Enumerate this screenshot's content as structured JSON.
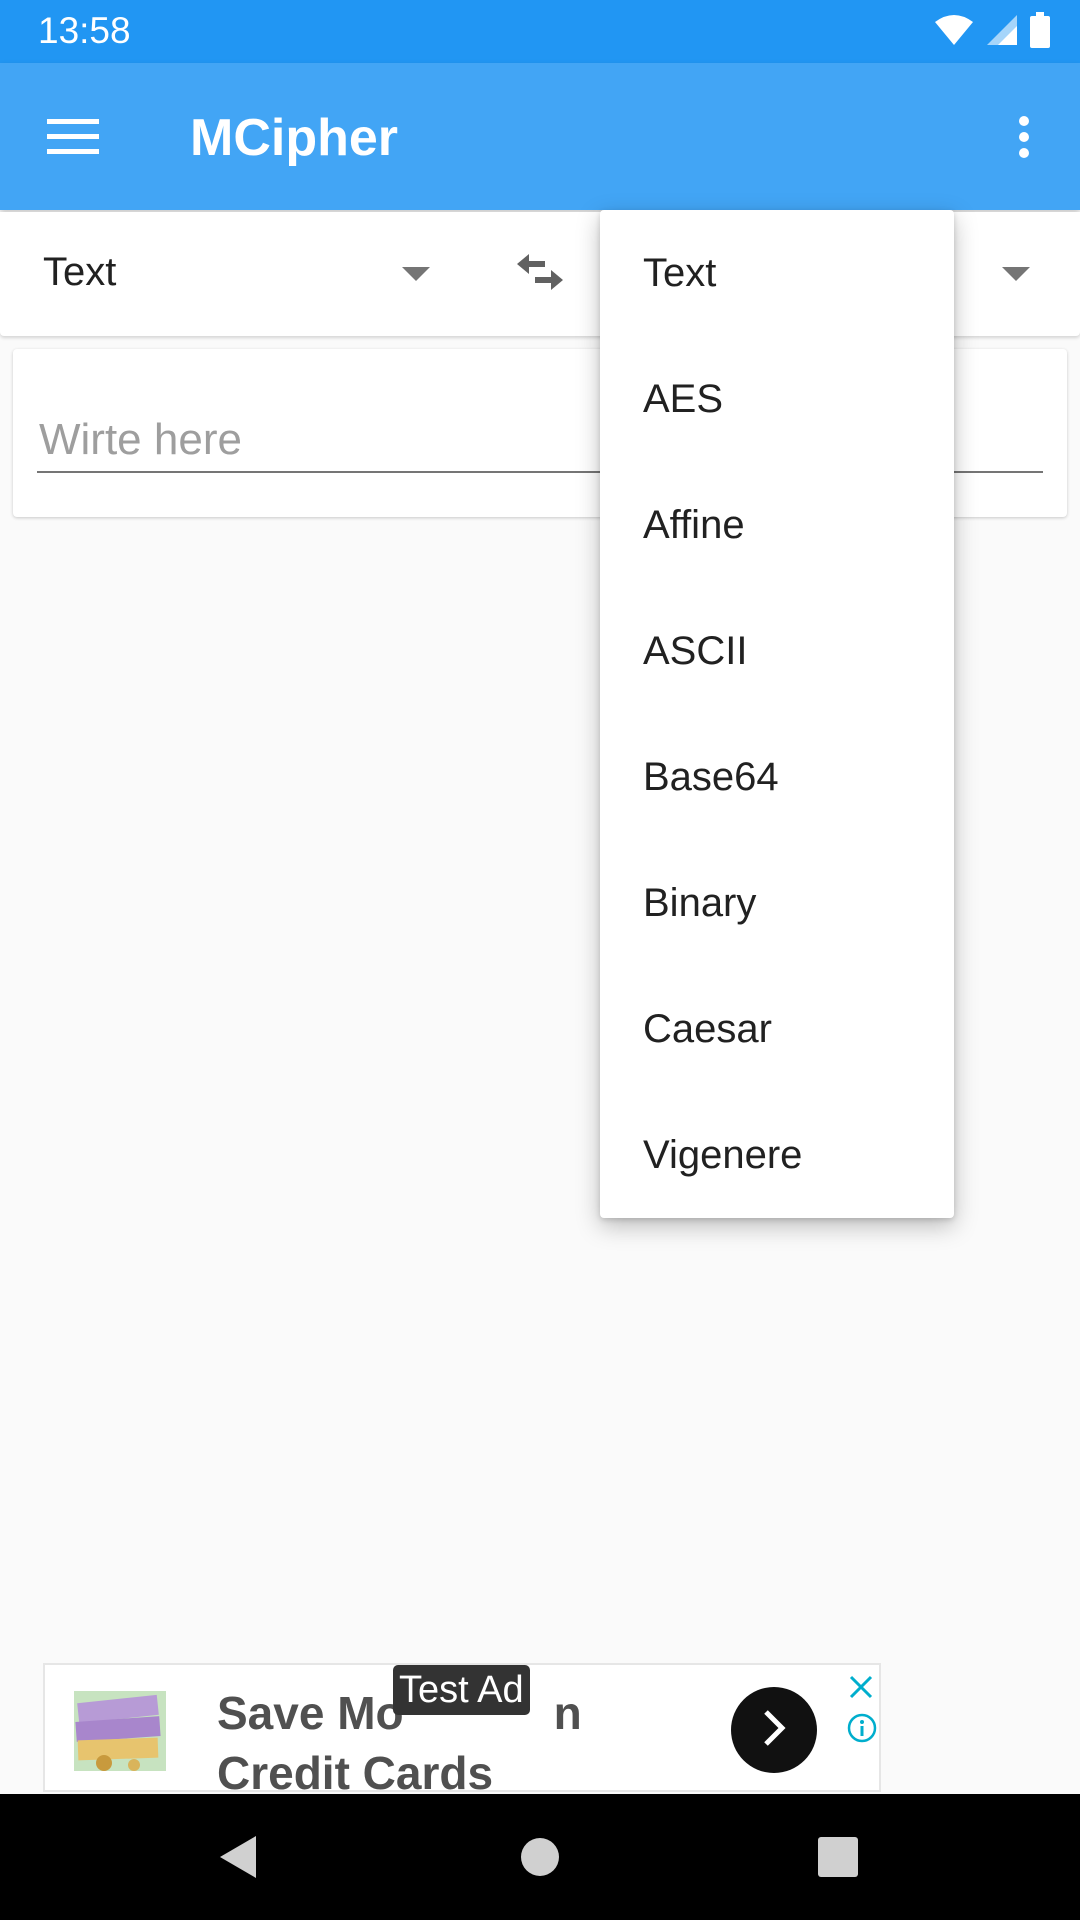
{
  "status_bar": {
    "time": "13:58",
    "icons": [
      "wifi-icon",
      "cell-signal-icon",
      "battery-icon"
    ]
  },
  "app_bar": {
    "title": "MCipher",
    "menu_icon": "hamburger-menu-icon",
    "overflow_icon": "more-vert-icon",
    "background_color": "#42a5f5"
  },
  "selector": {
    "left_value": "Text",
    "swap_icon": "swap-horiz-icon",
    "right_value": ""
  },
  "input": {
    "placeholder": "Wirte here",
    "value": ""
  },
  "dropdown": {
    "items": [
      "Text",
      "AES",
      "Affine",
      "ASCII",
      "Base64",
      "Binary",
      "Caesar",
      "Vigenere"
    ]
  },
  "ad": {
    "label": "Test Ad",
    "headline": "Save Money on Credit Cards",
    "headline_line1": "Save Mo",
    "headline_line1_end": "n",
    "headline_line2": "Credit Cards",
    "image_icon": "money-image-icon",
    "go_icon": "chevron-right-icon",
    "close_icon": "close-icon",
    "info_icon": "info-icon"
  },
  "nav_bar": {
    "back_icon": "back-icon",
    "home_icon": "home-icon",
    "recents_icon": "recents-icon"
  }
}
